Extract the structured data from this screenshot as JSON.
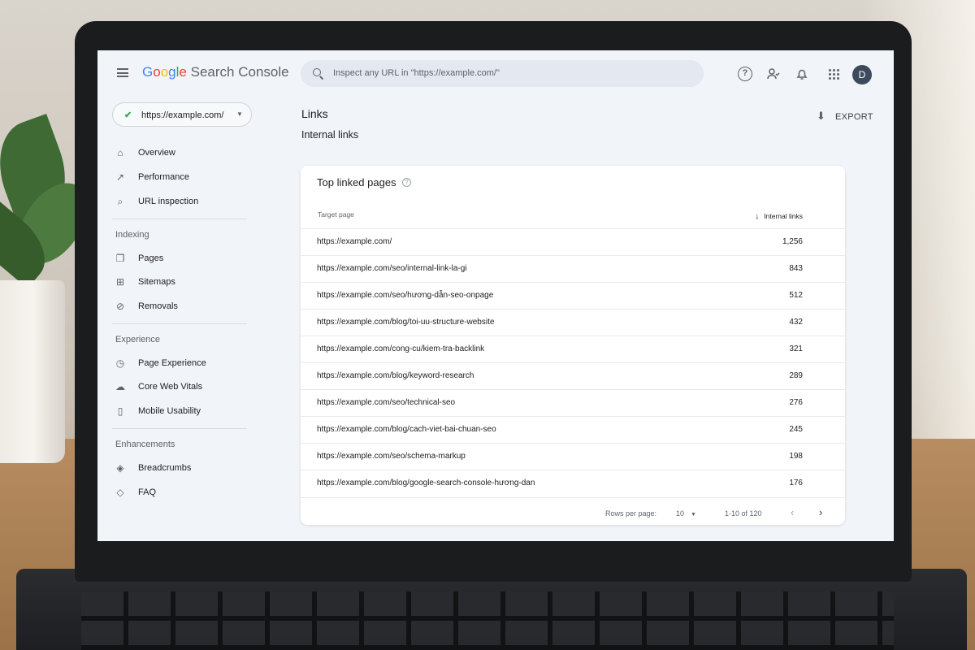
{
  "header": {
    "logo": [
      "G",
      "o",
      "o",
      "g",
      "l",
      "e"
    ],
    "product": "Search Console",
    "search_placeholder": "Inspect any URL in \"https://example.com/\"",
    "avatar_letter": "D"
  },
  "sidebar": {
    "property": "https://example.com/",
    "top_items": [
      {
        "label": "Overview",
        "icon": "home-icon"
      },
      {
        "label": "Performance",
        "icon": "trending-icon"
      },
      {
        "label": "URL inspection",
        "icon": "search-icon"
      }
    ],
    "sections": [
      {
        "label": "Indexing",
        "items": [
          {
            "label": "Pages",
            "icon": "pages-icon"
          },
          {
            "label": "Sitemaps",
            "icon": "sitemap-icon"
          },
          {
            "label": "Removals",
            "icon": "removals-icon"
          }
        ]
      },
      {
        "label": "Experience",
        "items": [
          {
            "label": "Page Experience",
            "icon": "page-experience-icon"
          },
          {
            "label": "Core Web Vitals",
            "icon": "core-web-vitals-icon"
          },
          {
            "label": "Mobile Usability",
            "icon": "mobile-icon"
          }
        ]
      },
      {
        "label": "Enhancements",
        "items": [
          {
            "label": "Breadcrumbs",
            "icon": "breadcrumbs-icon"
          },
          {
            "label": "FAQ",
            "icon": "faq-icon"
          }
        ]
      }
    ]
  },
  "main": {
    "title": "Links",
    "subtitle": "Internal links",
    "export_label": "EXPORT",
    "card": {
      "title": "Top linked pages",
      "col_target": "Target page",
      "col_links": "Internal links",
      "rows": [
        {
          "url": "https://example.com/",
          "links": "1,256"
        },
        {
          "url": "https://example.com/seo/internal-link-la-gi",
          "links": "843"
        },
        {
          "url": "https://example.com/seo/hương-dẫn-seo-onpage",
          "links": "512"
        },
        {
          "url": "https://example.com/blog/toi-uu-structure-website",
          "links": "432"
        },
        {
          "url": "https://example.com/cong-cu/kiem-tra-backlink",
          "links": "321"
        },
        {
          "url": "https://example.com/blog/keyword-research",
          "links": "289"
        },
        {
          "url": "https://example.com/seo/technical-seo",
          "links": "276"
        },
        {
          "url": "https://example.com/blog/cach-viet-bai-chuan-seo",
          "links": "245"
        },
        {
          "url": "https://example.com/seo/schema-markup",
          "links": "198"
        },
        {
          "url": "https://example.com/blog/google-search-console-hương-dan",
          "links": "176"
        }
      ],
      "rows_per_page_label": "Rows per page:",
      "rows_per_page": "10",
      "range": "1-10 of 120"
    }
  }
}
